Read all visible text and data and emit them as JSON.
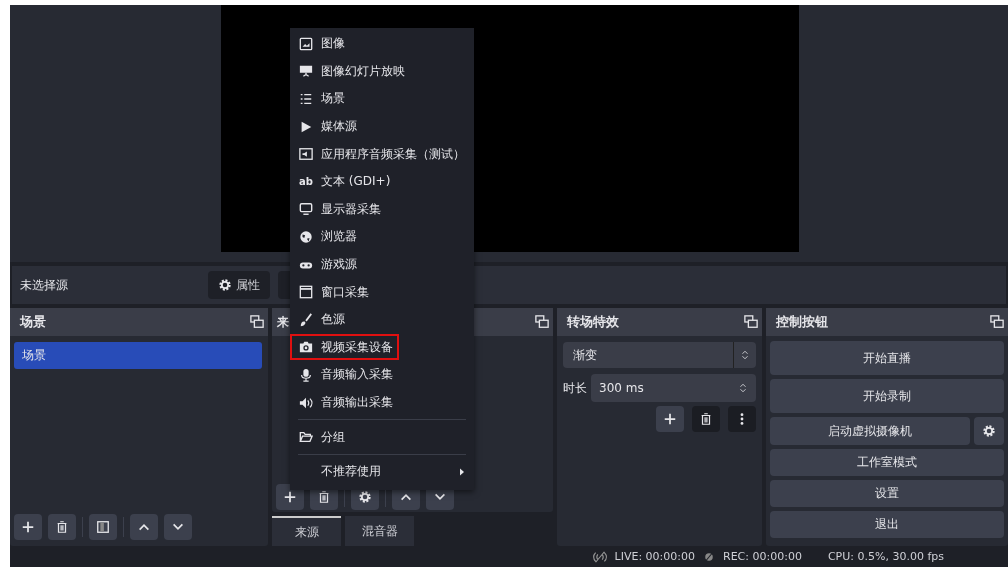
{
  "source_bar": {
    "label": "未选择源",
    "properties_button": "属性"
  },
  "scenes": {
    "title": "场景",
    "items": [
      {
        "label": "场景",
        "selected": true
      }
    ]
  },
  "sources": {
    "title": "来",
    "tabs": [
      {
        "label": "来源",
        "selected": true
      },
      {
        "label": "混音器",
        "selected": false
      }
    ]
  },
  "transitions": {
    "title": "转场特效",
    "transition": "渐变",
    "duration_label": "时长",
    "duration": "300 ms"
  },
  "controls": {
    "title": "控制按钮",
    "buttons": [
      "开始直播",
      "开始录制",
      "启动虚拟摄像机",
      "工作室模式",
      "设置",
      "退出"
    ]
  },
  "status_bar": {
    "live": "LIVE: 00:00:00",
    "rec": "REC: 00:00:00",
    "cpu": "CPU: 0.5%, 30.00 fps"
  },
  "context_menu": [
    {
      "kind": "item",
      "label": "图像",
      "highlighted": false
    },
    {
      "kind": "item",
      "label": "图像幻灯片放映",
      "highlighted": false
    },
    {
      "kind": "item",
      "label": "场景",
      "highlighted": false
    },
    {
      "kind": "item",
      "label": "媒体源",
      "highlighted": false
    },
    {
      "kind": "item",
      "label": "应用程序音频采集（测试）",
      "highlighted": false
    },
    {
      "kind": "item",
      "glyph": "ab",
      "label": "文本 (GDI+)",
      "highlighted": false
    },
    {
      "kind": "item",
      "label": "显示器采集",
      "highlighted": false
    },
    {
      "kind": "item",
      "label": "浏览器",
      "highlighted": false
    },
    {
      "kind": "item",
      "label": "游戏源",
      "highlighted": false
    },
    {
      "kind": "item",
      "label": "窗口采集",
      "highlighted": false
    },
    {
      "kind": "item",
      "label": "色源",
      "highlighted": false
    },
    {
      "kind": "item",
      "label": "视频采集设备",
      "highlighted": true
    },
    {
      "kind": "item",
      "label": "音频输入采集",
      "highlighted": false
    },
    {
      "kind": "item",
      "label": "音频输出采集",
      "highlighted": false
    },
    {
      "kind": "separator"
    },
    {
      "kind": "item",
      "label": "分组",
      "highlighted": false
    },
    {
      "kind": "separator"
    },
    {
      "kind": "submenu",
      "label": "不推荐使用",
      "highlighted": false
    }
  ]
}
